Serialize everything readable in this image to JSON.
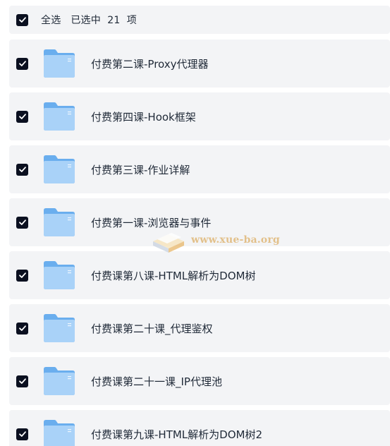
{
  "header": {
    "select_all_label": "全选   已选中  21  项"
  },
  "icons": {
    "checkbox": "check-icon",
    "folder": "folder-icon"
  },
  "colors": {
    "row_background": "#f3f4f6",
    "checkbox_fill": "#0b1020",
    "folder_blue": "#8ec1f4"
  },
  "items": [
    {
      "label": "付费第二课-Proxy代理器"
    },
    {
      "label": "付费第四课-Hook框架"
    },
    {
      "label": "付费第三课-作业详解"
    },
    {
      "label": "付费第一课-浏览器与事件"
    },
    {
      "label": "付费课第八课-HTML解析为DOM树"
    },
    {
      "label": "付费课第二十课_代理鉴权"
    },
    {
      "label": "付费课第二十一课_IP代理池"
    },
    {
      "label": "付费课第九课-HTML解析为DOM树2"
    }
  ],
  "watermark": {
    "text": "www.xue-ba.org"
  }
}
